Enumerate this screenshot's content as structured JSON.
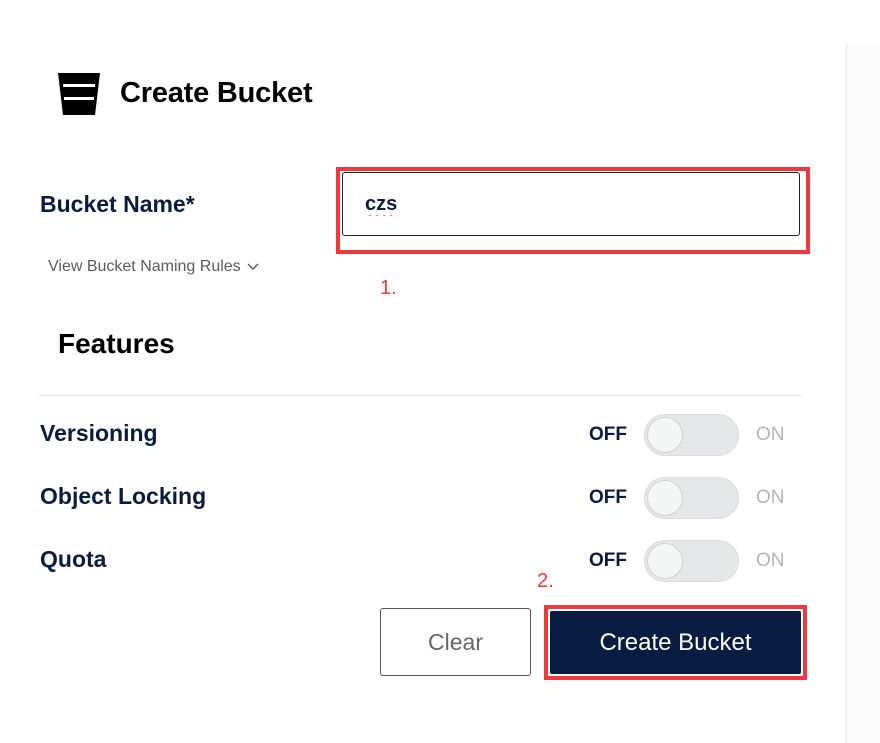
{
  "header": {
    "title": "Create Bucket",
    "icon": "bucket-icon"
  },
  "bucket_name": {
    "label": "Bucket Name*",
    "value": "czs",
    "naming_rules_link": "View Bucket Naming Rules"
  },
  "annotations": {
    "step1": "1.",
    "step2": "2."
  },
  "features": {
    "title": "Features",
    "items": [
      {
        "label": "Versioning",
        "off_label": "OFF",
        "on_label": "ON",
        "enabled": false
      },
      {
        "label": "Object Locking",
        "off_label": "OFF",
        "on_label": "ON",
        "enabled": false
      },
      {
        "label": "Quota",
        "off_label": "OFF",
        "on_label": "ON",
        "enabled": false
      }
    ]
  },
  "actions": {
    "clear_label": "Clear",
    "create_label": "Create Bucket"
  },
  "colors": {
    "primary": "#081c42",
    "highlight": "#ee3a3f"
  }
}
